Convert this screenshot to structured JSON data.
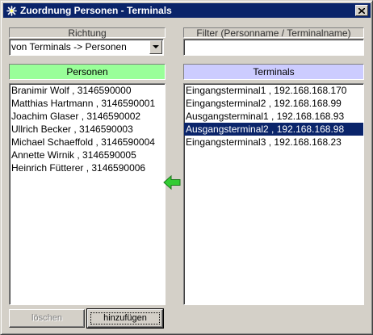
{
  "window": {
    "title": "Zuordnung Personen - Terminals",
    "close_glyph": "✕"
  },
  "direction": {
    "label": "Richtung",
    "selected": "von Terminals -> Personen"
  },
  "filter": {
    "label": "Filter (Personname / Terminalname)",
    "value": ""
  },
  "persons": {
    "header": "Personen",
    "header_color": "#99ff99",
    "items": [
      "Branimir Wolf , 3146590000",
      "Matthias Hartmann , 3146590001",
      "Joachim Glaser , 3146590002",
      "Ullrich Becker , 3146590003",
      "Michael Schaeffold , 3146590004",
      "Annette Wirnik , 3146590005",
      "Heinrich Fütterer , 3146590006"
    ]
  },
  "terminals": {
    "header": "Terminals",
    "header_color": "#ccccff",
    "selected_index": 3,
    "items": [
      "Eingangsterminal1 , 192.168.168.170",
      "Eingangsterminal2 , 192.168.168.99",
      "Ausgangsterminal1 , 192.168.168.93",
      "Ausgangsterminal2 , 192.168.168.98",
      "Eingangsterminal3 , 192.168.168.23"
    ]
  },
  "buttons": {
    "delete_label": "löschen",
    "add_label": "hinzufügen"
  },
  "icons": {
    "app": "star-icon",
    "transfer": "arrow-left-icon",
    "dropdown": "chevron-down-icon"
  },
  "colors": {
    "arrow": "#33cc33",
    "selection": "#0a246a"
  }
}
